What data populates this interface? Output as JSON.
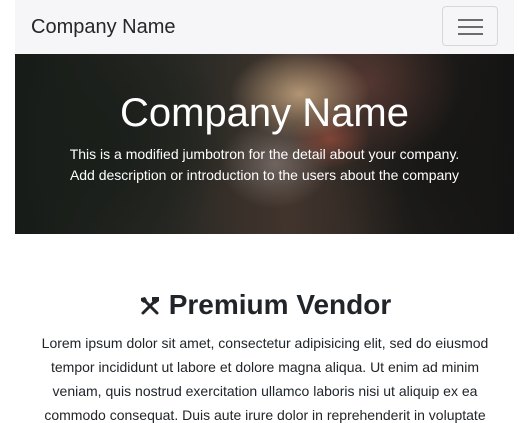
{
  "navbar": {
    "brand": "Company Name",
    "toggler_icon": "hamburger-menu-icon"
  },
  "jumbotron": {
    "title": "Company Name",
    "lines": [
      "This is a modified jumbotron for the detail about your company.",
      "Add description or introduction to the users about the company"
    ]
  },
  "vendor_section": {
    "icon": "tools-icon",
    "title": "Premium Vendor",
    "lines": [
      "Lorem ipsum dolor sit amet, consectetur adipisicing elit, sed do eiusmod",
      "tempor incididunt ut labore et dolore magna aliqua. Ut enim ad minim",
      "veniam, quis nostrud exercitation ullamco laboris nisi ut aliquip ex ea",
      "commodo consequat. Duis aute irure dolor in reprehenderit in voluptate"
    ]
  }
}
